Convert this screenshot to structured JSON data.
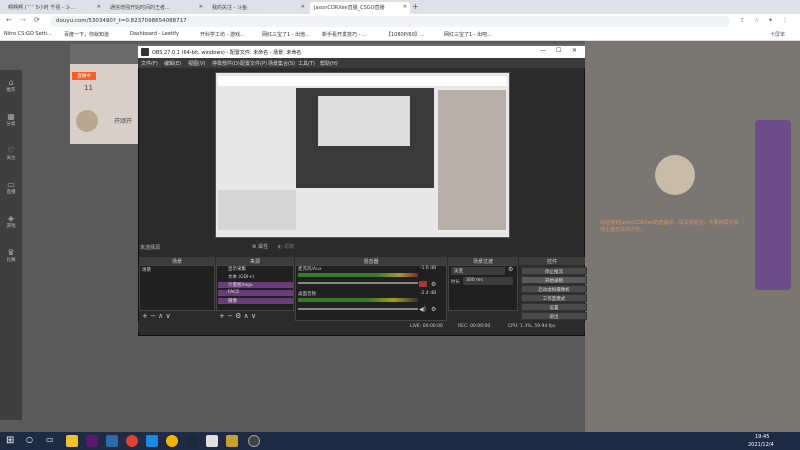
{
  "browser": {
    "tabs": [
      {
        "label": "啊啊啊 (ˉ˘ˉ 5小时 千禧 - 斗..."
      },
      {
        "label": "通信增强开始时间的王者..."
      },
      {
        "label": "我的关注 - 斗鱼"
      },
      {
        "label": "JasonCORXee直播_CSGO直播"
      }
    ],
    "url": "douyu.com/5303490?_t=0.8237098654088717",
    "bookmarks": [
      "Nitro CS:GO Setti...",
      "百度一下，你就知道",
      "Dashboard - Leetify",
      "开科学工坊 - 游戏...",
      "网红三宝了1 - 出他...",
      "新手看开发技巧 - ...",
      "【1080P/60】...",
      "网红三宝了1 - 出吧..."
    ],
    "right_label": "卡屏率"
  },
  "left_nav": [
    "推荐",
    "分类",
    "关注",
    "直播",
    "游戏",
    "比赛"
  ],
  "stream": {
    "badge": "直播中",
    "viewers": "11",
    "start_label": "开颂开",
    "chat_text": "欢迎来到JasonCORXee的直播间，请文明发言，不要刷屏与其他主播无关的内容。"
  },
  "obs": {
    "title": "OBS 27.0.1 (64-bit, windows) - 配置文件: 未命名 - 场景: 未命名",
    "menu": [
      "文件(F)",
      "编辑(E)",
      "视图(V)",
      "停靠部件(D)",
      "配置文件(P)",
      "场景集合(S)",
      "工具(T)",
      "帮助(H)"
    ],
    "panels": {
      "scenes": "场景",
      "sources": "来源",
      "mixer": "混音器",
      "transitions": "场景过渡",
      "controls": "控件"
    },
    "no_source": "未选择源",
    "props": "属性",
    "filters": "滤镜",
    "scene_item": "场景",
    "sources": [
      "显示采集",
      "文本 (GDI+)",
      "计量图/logo",
      "FACE",
      "摄像"
    ],
    "mixer": [
      {
        "name": "麦克风/Aux",
        "db": "-1.6 dB"
      },
      {
        "name": "桌面音频",
        "db": "-2.4 dB"
      }
    ],
    "transition": {
      "type": "淡变",
      "duration_label": "时长",
      "duration": "300 ms"
    },
    "controls": [
      "停止推流",
      "开始录制",
      "启动虚拟摄像机",
      "工作室模式",
      "设置",
      "退出"
    ],
    "status": {
      "live": "LIVE: 00:00:00",
      "rec": "REC: 00:00:00",
      "cpu": "CPU: 1.3%, 59.94 fps"
    }
  },
  "taskbar": {
    "time": "19:45",
    "date": "2021/12/4"
  },
  "colors": {
    "accent": "#ff5d23",
    "obs_bg": "#2b2b2b",
    "taskbar": "#1f2a44"
  }
}
